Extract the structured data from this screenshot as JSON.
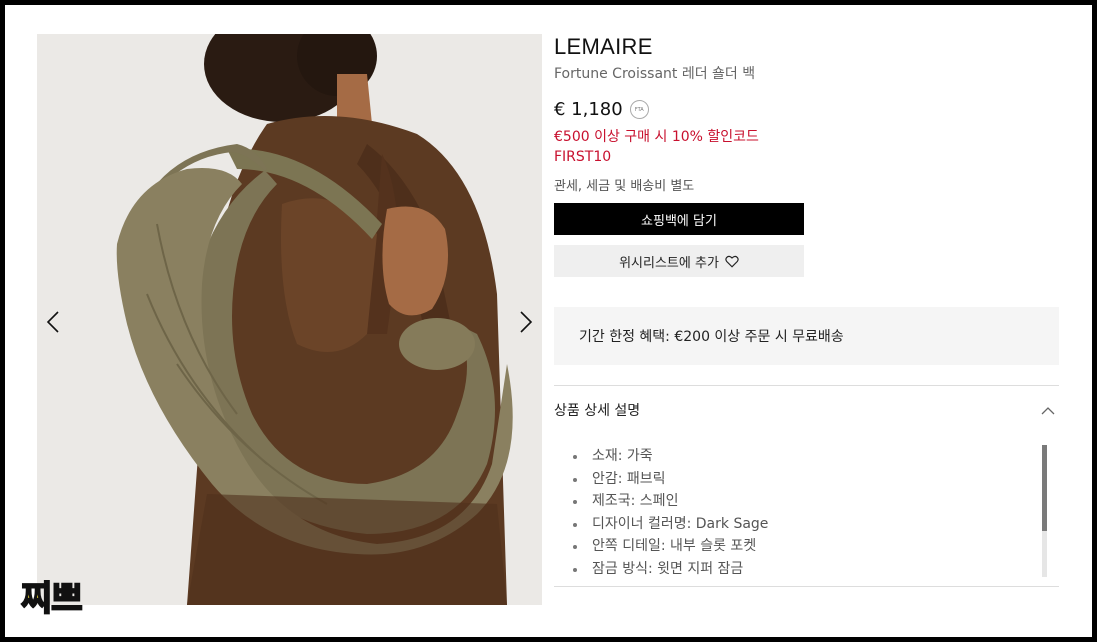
{
  "gallery": {
    "prev_icon": "chevron-left-icon",
    "next_icon": "chevron-right-icon",
    "watermark": "찌쁘"
  },
  "product": {
    "brand": "LEMAIRE",
    "name": "Fortune Croissant 레더 숄더 백",
    "price": "€ 1,180",
    "fta_badge": "FTA",
    "promo_line1": "€500 이상 구매 시 10% 할인코드",
    "promo_line2": "FIRST10",
    "tax_note": "관세, 세금 및 배송비 별도",
    "promo_color": "#c8102e"
  },
  "actions": {
    "add_to_cart": "쇼핑백에 담기",
    "add_to_wishlist": "위시리스트에 추가",
    "wishlist_icon": "heart-icon"
  },
  "benefit": {
    "text": "기간 한정 혜택: €200 이상 주문 시 무료배송"
  },
  "details_section": {
    "title": "상품 상세 설명",
    "toggle_icon": "chevron-up-icon",
    "items": [
      "소재: 가죽",
      "안감: 패브릭",
      "제조국: 스페인",
      "디자이너 컬러명: Dark Sage",
      "안쪽 디테일: 내부 슬롯 포켓",
      "잠금 방식: 윗면 지퍼 잠금"
    ]
  }
}
